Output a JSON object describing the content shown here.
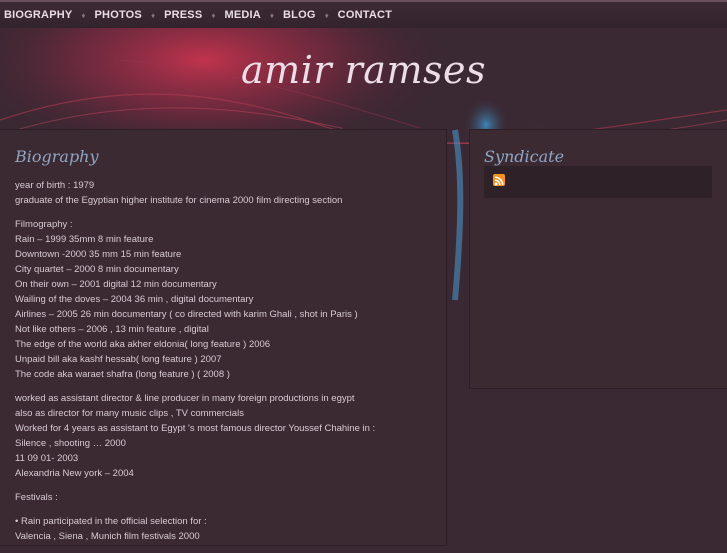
{
  "nav": {
    "items": [
      "BIOGRAPHY",
      "PHOTOS",
      "PRESS",
      "MEDIA",
      "BLOG",
      "CONTACT"
    ],
    "separator": "♦"
  },
  "site_title": "amir ramses",
  "main": {
    "heading": "Biography",
    "paragraphs": [
      [
        "year of birth : 1979",
        "graduate of the Egyptian higher institute for cinema 2000 film directing section"
      ],
      [
        "Filmography :",
        "Rain – 1999 35mm 8 min feature",
        "Downtown -2000 35 mm 15 min feature",
        "City quartet – 2000 8 min documentary",
        "On their own – 2001 digital 12 min documentary",
        "Wailing of the doves – 2004 36 min , digital documentary",
        "Airlines – 2005 26 min documentary ( co directed with karim Ghali , shot in Paris )",
        "Not like others – 2006 , 13 min feature , digital",
        "The edge of the world aka akher eldonia( long feature ) 2006",
        "Unpaid bill aka kashf hessab( long feature ) 2007",
        "The code aka waraet shafra (long feature ) ( 2008 )"
      ],
      [
        "worked as assistant director & line producer in many foreign productions in egypt",
        "also as director for many music clips , TV commercials",
        "Worked for 4 years as assistant to Egypt 's most famous director Youssef Chahine in :",
        "Silence , shooting … 2000",
        "11 09 01- 2003",
        "Alexandria New york – 2004"
      ],
      [
        "Festivals :"
      ],
      [
        "• Rain participated in the official selection for :",
        "Valencia , Siena , Munich film festivals 2000"
      ]
    ]
  },
  "sidebar": {
    "heading": "Syndicate",
    "feed_icon": "rss-icon"
  },
  "colors": {
    "background": "#3a2832",
    "panel": "#3c2a33",
    "heading": "#8fa5c4",
    "text": "#d8cbd2",
    "accent_red": "#c8344e",
    "accent_blue": "#3f8fc4",
    "rss": "#f39326"
  }
}
